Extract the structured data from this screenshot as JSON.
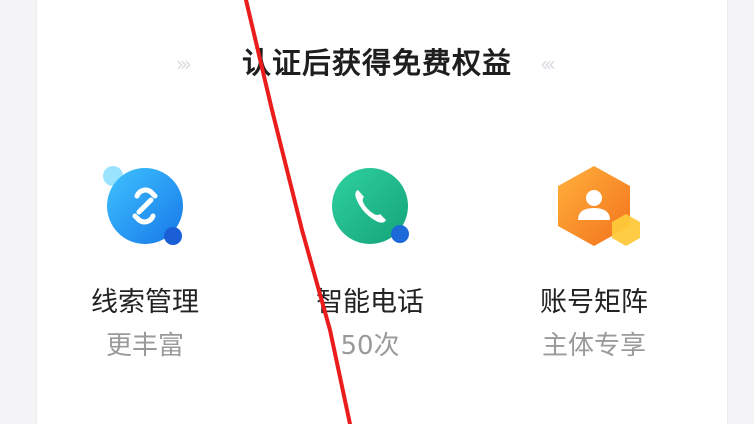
{
  "heading": "认证后获得免费权益",
  "decorations": {
    "left": "›››",
    "right": "‹‹‹"
  },
  "benefits": [
    {
      "title": "线索管理",
      "subtitle": "更丰富",
      "icon": "link-icon",
      "color": "#1e9bf0"
    },
    {
      "title": "智能电话",
      "subtitle": "50次",
      "icon": "phone-icon",
      "color": "#1fb58a"
    },
    {
      "title": "账号矩阵",
      "subtitle": "主体专享",
      "icon": "account-icon",
      "color": "#f6922a"
    }
  ]
}
